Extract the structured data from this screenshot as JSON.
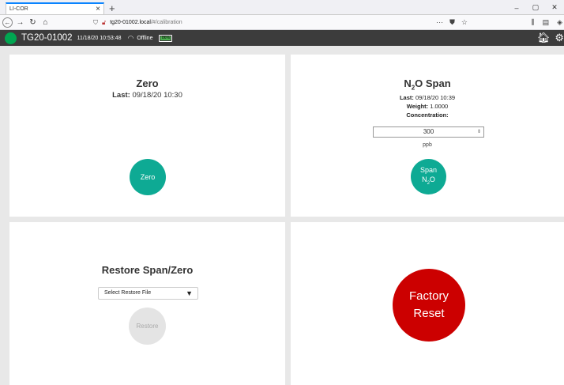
{
  "browser": {
    "tab_title": "LI-COR",
    "tab_close": "×",
    "new_tab": "+",
    "url_host": "tg20-01002.local",
    "url_path": "/#/calibration",
    "win_min": "–",
    "win_max": "▢",
    "win_close": "✕"
  },
  "appbar": {
    "device": "TG20-01002",
    "datetime": "11/18/20 10:53:48",
    "status": "Offline",
    "battery_percent": "86%",
    "battery_level": 0.86,
    "status_color": "#00a651"
  },
  "zero": {
    "title": "Zero",
    "last_label": "Last:",
    "last_value": "09/18/20 10:30",
    "button": "Zero"
  },
  "span": {
    "title_n": "N",
    "title_sub": "2",
    "title_rest": "O Span",
    "last_label": "Last:",
    "last_value": "09/18/20 10:39",
    "weight_label": "Weight:",
    "weight_value": "1.0000",
    "conc_label": "Concentration:",
    "conc_value": "300",
    "unit": "ppb",
    "button_line1": "Span",
    "button_n": "N",
    "button_sub": "2",
    "button_o": "O"
  },
  "restore": {
    "title": "Restore Span/Zero",
    "select_value": "Select Restore File",
    "button": "Restore"
  },
  "factory": {
    "line1": "Factory",
    "line2": "Reset"
  },
  "colors": {
    "accent_teal": "#0eaa94",
    "factory_red": "#cc0000",
    "appbar_bg": "#3c3c3c"
  }
}
